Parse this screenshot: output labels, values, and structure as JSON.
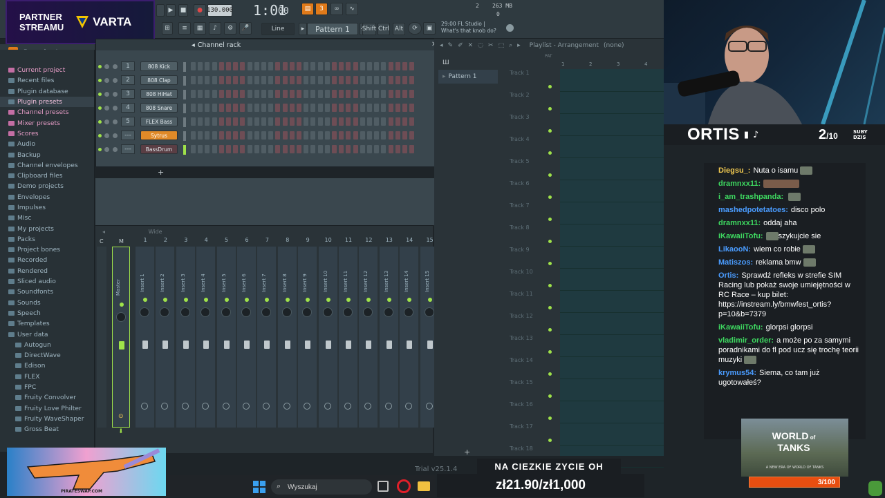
{
  "toolbar": {
    "tempo": "130.000",
    "time": "1:01",
    "time_ticks": "00",
    "pattern": "Pattern 1",
    "snap": "Line",
    "mem": "263 MB",
    "cpu": "2",
    "poly": "0",
    "hint_time": "29:00",
    "hint_text": "FL Studio | What's that knob do?",
    "mod_keys": [
      "Shift",
      "Ctrl",
      "Alt"
    ],
    "pat_label": "PAT"
  },
  "partner": {
    "line1": "PARTNER",
    "line2": "STREAMU",
    "brand": "VARTA"
  },
  "browser": {
    "items": [
      {
        "label": "Current project",
        "style": "pink"
      },
      {
        "label": "Recent files",
        "style": ""
      },
      {
        "label": "Plugin database",
        "style": ""
      },
      {
        "label": "Plugin presets",
        "style": "hi"
      },
      {
        "label": "Channel presets",
        "style": "pink"
      },
      {
        "label": "Mixer presets",
        "style": "pink"
      },
      {
        "label": "Scores",
        "style": "pink"
      },
      {
        "label": "Audio",
        "style": ""
      },
      {
        "label": "Backup",
        "style": ""
      },
      {
        "label": "Channel envelopes",
        "style": ""
      },
      {
        "label": "Clipboard files",
        "style": ""
      },
      {
        "label": "Demo projects",
        "style": ""
      },
      {
        "label": "Envelopes",
        "style": ""
      },
      {
        "label": "Impulses",
        "style": ""
      },
      {
        "label": "Misc",
        "style": ""
      },
      {
        "label": "My projects",
        "style": ""
      },
      {
        "label": "Packs",
        "style": ""
      },
      {
        "label": "Project bones",
        "style": ""
      },
      {
        "label": "Recorded",
        "style": ""
      },
      {
        "label": "Rendered",
        "style": ""
      },
      {
        "label": "Sliced audio",
        "style": ""
      },
      {
        "label": "Soundfonts",
        "style": ""
      },
      {
        "label": "Sounds",
        "style": ""
      },
      {
        "label": "Speech",
        "style": ""
      },
      {
        "label": "Templates",
        "style": ""
      },
      {
        "label": "User data",
        "style": ""
      },
      {
        "label": "Autogun",
        "style": "sub"
      },
      {
        "label": "DirectWave",
        "style": "sub"
      },
      {
        "label": "Edison",
        "style": "sub"
      },
      {
        "label": "FLEX",
        "style": "sub"
      },
      {
        "label": "FPC",
        "style": "sub"
      },
      {
        "label": "Fruity Convolver",
        "style": "sub"
      },
      {
        "label": "Fruity Love Philter",
        "style": "sub"
      },
      {
        "label": "Fruity WaveShaper",
        "style": "sub"
      },
      {
        "label": "Gross Beat",
        "style": "sub"
      }
    ]
  },
  "rack": {
    "title": "Channel rack",
    "add": "+",
    "channels": [
      {
        "num": "1",
        "name": "808 Kick",
        "style": ""
      },
      {
        "num": "2",
        "name": "808 Clap",
        "style": ""
      },
      {
        "num": "3",
        "name": "808 HiHat",
        "style": ""
      },
      {
        "num": "4",
        "name": "808 Snare",
        "style": ""
      },
      {
        "num": "5",
        "name": "FLEX Bass",
        "style": ""
      },
      {
        "num": "---",
        "name": "Sytrus",
        "style": "orange"
      },
      {
        "num": "---",
        "name": "BassDrum",
        "style": "red"
      }
    ]
  },
  "mixer": {
    "preset": "Wide",
    "master_label": "Master",
    "col_c": "C",
    "col_m": "M",
    "inserts": [
      "Insert 1",
      "Insert 2",
      "Insert 3",
      "Insert 4",
      "Insert 5",
      "Insert 6",
      "Insert 7",
      "Insert 8",
      "Insert 9",
      "Insert 10",
      "Insert 11",
      "Insert 12",
      "Insert 13",
      "Insert 14",
      "Insert 15"
    ],
    "numbers": [
      "1",
      "2",
      "3",
      "4",
      "5",
      "6",
      "7",
      "8",
      "9",
      "10",
      "11",
      "12",
      "13",
      "14",
      "15"
    ]
  },
  "playlist": {
    "title": "Playlist - Arrangement",
    "none": "(none)",
    "pattern": "Pattern 1",
    "bars": [
      "1",
      "2",
      "3",
      "4"
    ],
    "tracks": [
      "Track 1",
      "Track 2",
      "Track 3",
      "Track 4",
      "Track 5",
      "Track 6",
      "Track 7",
      "Track 8",
      "Track 9",
      "Track 10",
      "Track 11",
      "Track 12",
      "Track 13",
      "Track 14",
      "Track 15",
      "Track 16",
      "Track 17",
      "Track 18"
    ],
    "add": "+"
  },
  "stream": {
    "name": "ORTIS",
    "subs_count": "2",
    "subs_goal": "/10",
    "subs_label1": "SUBY",
    "subs_label2": "DZIS"
  },
  "chat": [
    {
      "user": "Diegsu_:",
      "color": "#f0c850",
      "text": "Nuta o isamu",
      "emote": "small"
    },
    {
      "user": "dramnxx11:",
      "color": "#3ed860",
      "text": "",
      "emote": "wide"
    },
    {
      "user": "i_am_trashpanda:",
      "color": "#3ed860",
      "text": "",
      "emote": "small"
    },
    {
      "user": "mashedpotetatoes:",
      "color": "#4a9cff",
      "text": "disco polo",
      "emote": ""
    },
    {
      "user": "dramnxx11:",
      "color": "#3ed860",
      "text": "oddaj aha",
      "emote": ""
    },
    {
      "user": "iKawaiiTofu:",
      "color": "#3ed860",
      "text": "szykujcie sie",
      "emote": "pre"
    },
    {
      "user": "LikaooN:",
      "color": "#4a9cff",
      "text": "wiem co robie",
      "emote": "small"
    },
    {
      "user": "Matiszos:",
      "color": "#4a9cff",
      "text": "reklama bmw",
      "emote": "small"
    },
    {
      "user": "Ortis:",
      "color": "#4a9cff",
      "text": "Sprawdź refleks w strefie SIM Racing lub pokaż swoje umiejętności w RC Race – kup bilet: https://instream.ly/bmwfest_ortis?p=10&b=7379",
      "emote": ""
    },
    {
      "user": "iKawaiiTofu:",
      "color": "#3ed860",
      "text": "glorpsi glorpsi",
      "emote": ""
    },
    {
      "user": "vladimir_order:",
      "color": "#3ed860",
      "text": "a może po za samymi poradnikami do fl pod ucz się trochę teorii muzyki",
      "emote": "small"
    },
    {
      "user": "krymus54:",
      "color": "#4a9cff",
      "text": "Siema, co tam już ugotowałeś?",
      "emote": ""
    }
  ],
  "wot": {
    "logo1": "WORLD",
    "logo2": "TANKS",
    "sub": "A NEW ERA OF WORLD OF TANKS",
    "goal": "3/100"
  },
  "bottom": {
    "banner": "NA CIEZKIE ZYCIE OH",
    "price": "zł21.90/zł1,000",
    "trial": "Trial v25.1.4",
    "search": "Wyszukaj",
    "gun_site": "PIRATESWAP.COM"
  }
}
